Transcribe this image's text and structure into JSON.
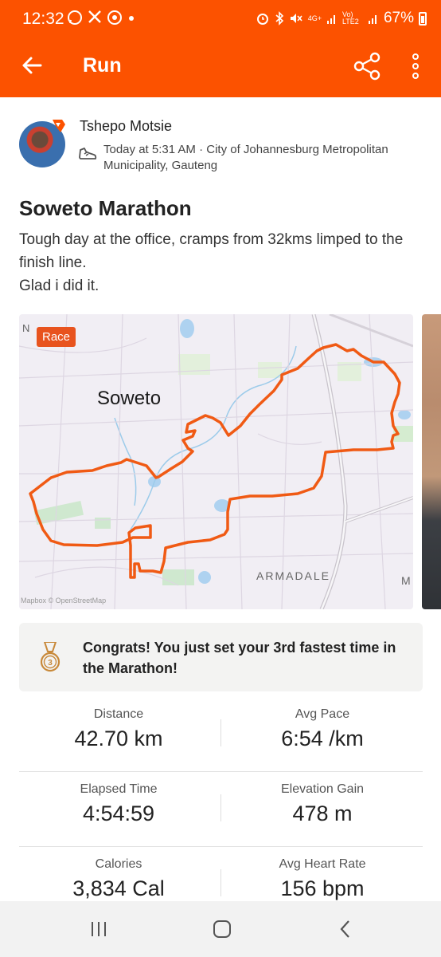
{
  "status_bar": {
    "time": "12:32",
    "notification_icons": [
      "whatsapp-icon",
      "x-icon",
      "app-icon",
      "dot"
    ],
    "network_label_1": "4G+",
    "network_label_2": "Vo) LTE2",
    "battery": "67%"
  },
  "app_bar": {
    "title": "Run",
    "accent_color": "#fc5200"
  },
  "athlete": {
    "name": "Tshepo Motsie",
    "meta": "Today at 5:31 AM · City of Johannesburg Metropolitan Municipality, Gauteng"
  },
  "activity": {
    "title": "Soweto Marathon",
    "description": "Tough day at the office, cramps from 32kms limped to the finish line.\nGlad i did it."
  },
  "map": {
    "badge": "Race",
    "label_city": "Soweto",
    "label_area": "ARMADALE",
    "label_edge_n": "N",
    "label_edge_m": "M",
    "attribution": "Mapbox © OpenStreetMap",
    "route_color": "#f05a14"
  },
  "achievement": {
    "icon": "medal-icon",
    "rank": "3",
    "text": "Congrats! You just set your 3rd fastest time in the Marathon!"
  },
  "stats": [
    {
      "label": "Distance",
      "value": "42.70 km"
    },
    {
      "label": "Avg Pace",
      "value": "6:54 /km"
    },
    {
      "label": "Elapsed Time",
      "value": "4:54:59"
    },
    {
      "label": "Elevation Gain",
      "value": "478 m"
    },
    {
      "label": "Calories",
      "value": "3,834 Cal"
    },
    {
      "label": "Avg Heart Rate",
      "value": "156 bpm"
    }
  ]
}
